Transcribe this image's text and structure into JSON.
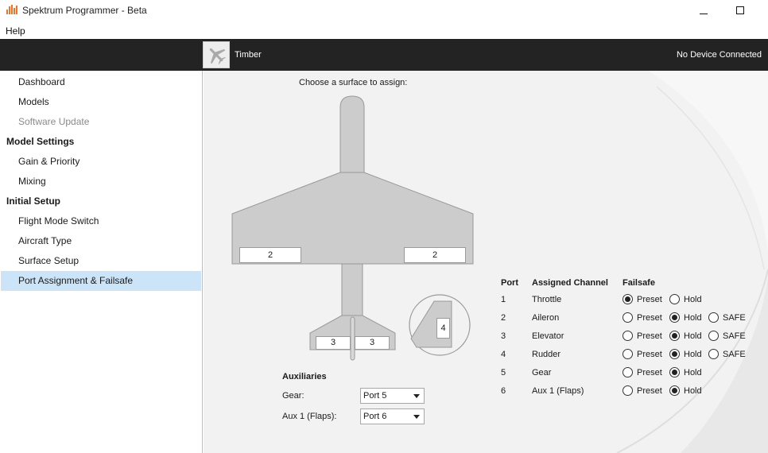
{
  "window": {
    "title": "Spektrum Programmer - Beta",
    "minimize_glyph": "—",
    "maximize_glyph": "□"
  },
  "menu": {
    "help": "Help"
  },
  "header": {
    "model_name": "Timber",
    "device_status": "No Device Connected",
    "model_icon": "airplane-icon"
  },
  "sidebar": {
    "items": [
      {
        "label": "Dashboard",
        "kind": "item"
      },
      {
        "label": "Models",
        "kind": "item"
      },
      {
        "label": "Software Update",
        "kind": "disabled"
      },
      {
        "label": "Model Settings",
        "kind": "section"
      },
      {
        "label": "Gain & Priority",
        "kind": "item"
      },
      {
        "label": "Mixing",
        "kind": "item"
      },
      {
        "label": "Initial Setup",
        "kind": "section"
      },
      {
        "label": "Flight Mode Switch",
        "kind": "item"
      },
      {
        "label": "Aircraft Type",
        "kind": "item"
      },
      {
        "label": "Surface Setup",
        "kind": "item"
      },
      {
        "label": "Port Assignment & Failsafe",
        "kind": "selected"
      }
    ]
  },
  "surfaces": {
    "prompt": "Choose a surface to assign:",
    "left_aileron": "2",
    "right_aileron": "2",
    "left_elevator": "3",
    "right_elevator": "3",
    "rudder": "4"
  },
  "auxiliaries": {
    "title": "Auxiliaries",
    "rows": [
      {
        "label": "Gear:",
        "value": "Port 5"
      },
      {
        "label": "Aux 1 (Flaps):",
        "value": "Port 6"
      }
    ]
  },
  "ports": {
    "headers": {
      "port": "Port",
      "channel": "Assigned Channel",
      "failsafe": "Failsafe"
    },
    "option_labels": {
      "preset": "Preset",
      "hold": "Hold",
      "safe": "SAFE"
    },
    "rows": [
      {
        "port": "1",
        "channel": "Throttle",
        "selected": "Preset",
        "has_safe": false
      },
      {
        "port": "2",
        "channel": "Aileron",
        "selected": "Hold",
        "has_safe": true
      },
      {
        "port": "3",
        "channel": "Elevator",
        "selected": "Hold",
        "has_safe": true
      },
      {
        "port": "4",
        "channel": "Rudder",
        "selected": "Hold",
        "has_safe": true
      },
      {
        "port": "5",
        "channel": "Gear",
        "selected": "Hold",
        "has_safe": false
      },
      {
        "port": "6",
        "channel": "Aux 1 (Flaps)",
        "selected": "Hold",
        "has_safe": false
      }
    ]
  },
  "colors": {
    "topbar": "#232323",
    "selection": "#cce4f7",
    "panel": "#f2f2f2",
    "airframe": "#cccccc",
    "app_icon": "#e8772e"
  }
}
